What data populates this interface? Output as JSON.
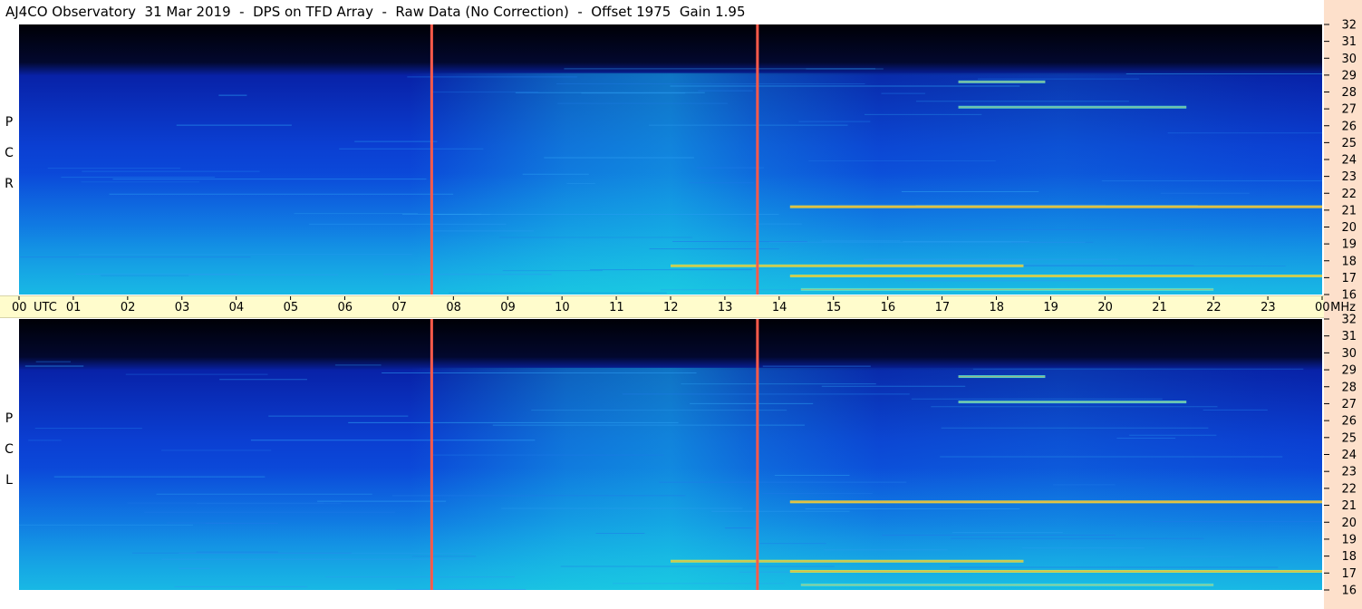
{
  "title": "AJ4CO Observatory  31 Mar 2019  -  DPS on TFD Array  -  Raw Data (No Correction)  -  Offset 1975  Gain 1.95",
  "colors": {
    "background_dark": "#000008",
    "spectrogram_base": "#0a3ecf",
    "marker_line": "#ff5a4a",
    "time_bar": "#fffccc",
    "right_strip": "#fde0cb",
    "signal_hot": "#f5e630"
  },
  "chart_data": {
    "type": "heatmap",
    "x": {
      "unit": "UTC",
      "ticks": [
        "00",
        "01",
        "02",
        "03",
        "04",
        "05",
        "06",
        "07",
        "08",
        "09",
        "10",
        "11",
        "12",
        "13",
        "14",
        "15",
        "16",
        "17",
        "18",
        "19",
        "20",
        "21",
        "22",
        "23",
        "00"
      ],
      "range": [
        0,
        24
      ],
      "first_tick_suffix": "UTC",
      "last_tick_suffix": "MHz"
    },
    "y": {
      "unit": "MHz",
      "ticks": [
        "32",
        "31",
        "30",
        "29",
        "28",
        "27",
        "26",
        "25",
        "24",
        "23",
        "22",
        "21",
        "20",
        "19",
        "18",
        "17",
        "16"
      ],
      "range": [
        16,
        32
      ]
    },
    "panels": [
      {
        "label": [
          "R",
          "C",
          "P"
        ]
      },
      {
        "label": [
          "L",
          "C",
          "P"
        ]
      }
    ],
    "markers_utc": [
      7.6,
      13.6
    ],
    "bright_bands": [
      {
        "freq_mhz": 21.2,
        "start_utc": 14.2,
        "end_utc": 24.0,
        "intensity": 0.95
      },
      {
        "freq_mhz": 17.7,
        "start_utc": 12.0,
        "end_utc": 18.5,
        "intensity": 0.8
      },
      {
        "freq_mhz": 17.1,
        "start_utc": 14.2,
        "end_utc": 24.0,
        "intensity": 0.85
      },
      {
        "freq_mhz": 16.3,
        "start_utc": 14.4,
        "end_utc": 22.0,
        "intensity": 0.7
      },
      {
        "freq_mhz": 28.6,
        "start_utc": 17.3,
        "end_utc": 18.9,
        "intensity": 0.7
      },
      {
        "freq_mhz": 27.1,
        "start_utc": 17.3,
        "end_utc": 21.5,
        "intensity": 0.55
      }
    ]
  }
}
